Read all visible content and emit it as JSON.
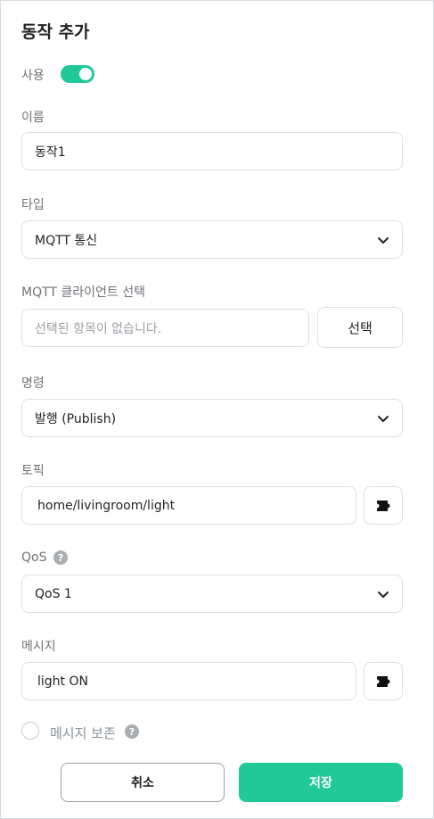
{
  "title": "동작 추가",
  "enable": {
    "label": "사용",
    "on": true
  },
  "name": {
    "label": "이름",
    "value": "동작1"
  },
  "type": {
    "label": "타입",
    "selected": "MQTT 통신"
  },
  "client": {
    "label": "MQTT 클라이언트 선택",
    "placeholder": "선택된 항목이 없습니다.",
    "select_label": "선택"
  },
  "command": {
    "label": "명령",
    "selected": "발행 (Publish)"
  },
  "topic": {
    "label": "토픽",
    "value": "home/livingroom/light"
  },
  "qos": {
    "label": "QoS",
    "help": "?",
    "selected": "QoS 1"
  },
  "message": {
    "label": "메시지",
    "value": "light ON"
  },
  "retain": {
    "label": "메시지 보존",
    "help": "?",
    "checked": false
  },
  "buttons": {
    "cancel": "취소",
    "save": "저장"
  },
  "colors": {
    "accent": "#20c997",
    "border": "#dcdfe3",
    "label": "#6e7378"
  }
}
